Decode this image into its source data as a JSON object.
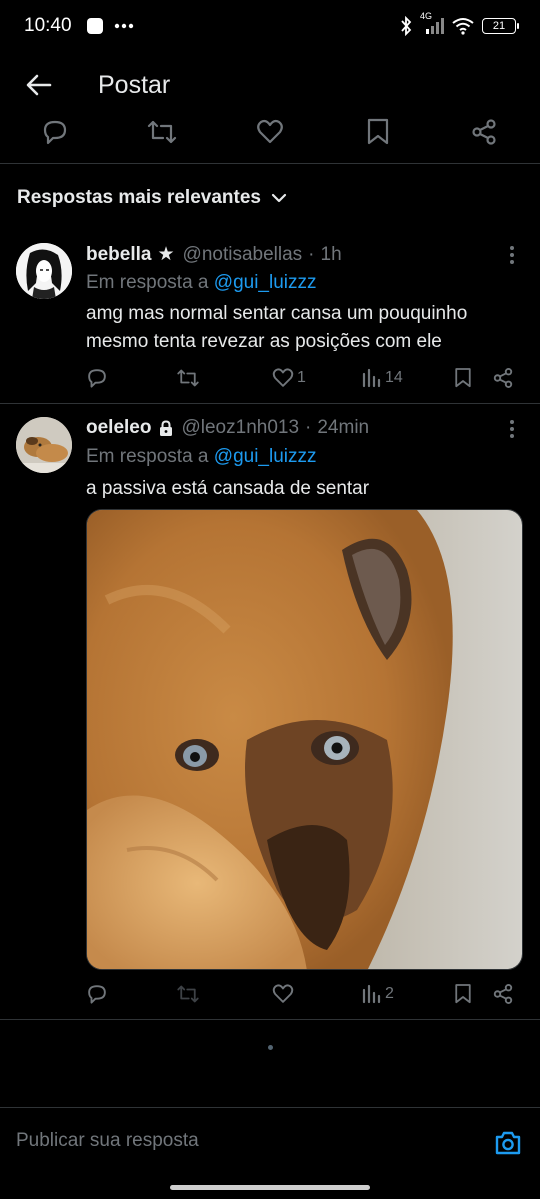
{
  "status_bar": {
    "time": "10:40",
    "network": "4G",
    "battery": "21"
  },
  "header": {
    "title": "Postar"
  },
  "sort": {
    "label": "Respostas mais relevantes"
  },
  "replies": [
    {
      "display_name": "bebella",
      "badge": "★",
      "handle": "@notisabellas",
      "time": "1h",
      "reply_to_prefix": "Em resposta a",
      "reply_to_handle": "@gui_luizzz",
      "text": "amg mas normal sentar cansa um pouquinho mesmo tenta revezar as posições com ele",
      "likes": "1",
      "views": "14"
    },
    {
      "display_name": "oeleleo",
      "badge": "lock-icon",
      "handle": "@leoz1nh013",
      "time": "24min",
      "reply_to_prefix": "Em resposta a",
      "reply_to_handle": "@gui_luizzz",
      "text": "a passiva está cansada de sentar",
      "views": "2"
    }
  ],
  "composer": {
    "placeholder": "Publicar sua resposta"
  },
  "colors": {
    "background": "#000000",
    "text": "#e7e9ea",
    "secondary": "#71767b",
    "link": "#1d9bf0",
    "divider": "#2f3336"
  }
}
